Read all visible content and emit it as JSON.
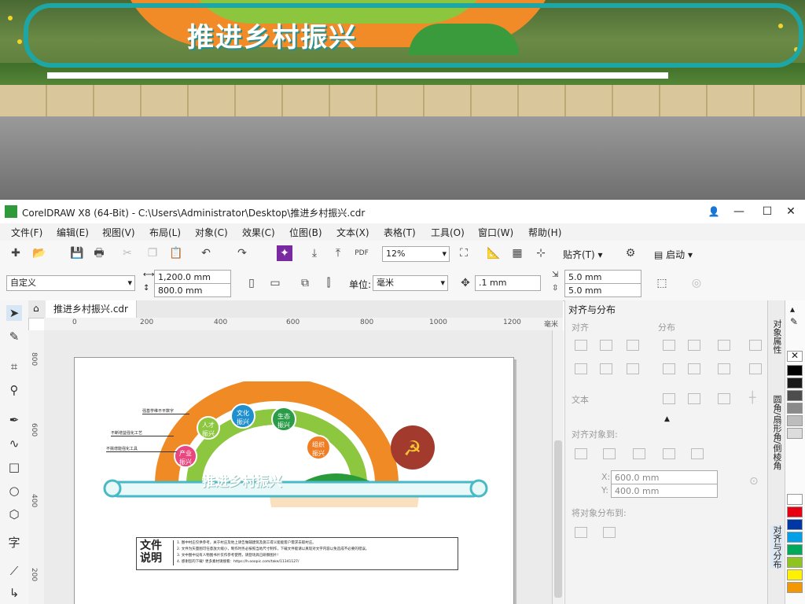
{
  "photo": {
    "banner_text": "推进乡村振兴"
  },
  "window": {
    "title": "CorelDRAW X8 (64-Bit) - C:\\Users\\Administrator\\Desktop\\推进乡村振兴.cdr",
    "controls": {
      "minimize": "—",
      "maximize": "☐",
      "close": "✕"
    }
  },
  "menu": [
    "文件(F)",
    "编辑(E)",
    "视图(V)",
    "布局(L)",
    "对象(C)",
    "效果(C)",
    "位图(B)",
    "文本(X)",
    "表格(T)",
    "工具(O)",
    "窗口(W)",
    "帮助(H)"
  ],
  "toolbar1": {
    "zoom": "12%",
    "snap_label": "贴齐(T)",
    "launch_label": "启动"
  },
  "toolbar2": {
    "page_preset": "自定义",
    "width": "1,200.0 mm",
    "height": "800.0 mm",
    "units_label": "单位:",
    "units_value": "毫米",
    "nudge": ".1 mm",
    "dup_x": "5.0 mm",
    "dup_y": "5.0 mm"
  },
  "document": {
    "tab": "推进乡村振兴.cdr"
  },
  "ruler_h": [
    "0",
    "200",
    "400",
    "600",
    "800",
    "1000",
    "1200"
  ],
  "ruler_h_unit": "毫米",
  "ruler_v": [
    "800",
    "600",
    "400",
    "200"
  ],
  "artwork": {
    "banner": "推进乡村振兴",
    "circles": [
      {
        "line1": "产业",
        "line2": "振兴",
        "color": "#e9457e"
      },
      {
        "line1": "人才",
        "line2": "振兴",
        "color": "#8dc63f"
      },
      {
        "line1": "文化",
        "line2": "振兴",
        "color": "#1f8fce"
      },
      {
        "line1": "生态",
        "line2": "振兴",
        "color": "#2a9b47"
      },
      {
        "line1": "组织",
        "line2": "振兴",
        "color": "#f07e25"
      }
    ],
    "callouts": [
      "强基学维不平数字",
      "不断增益强化工艺",
      "不挑增能强化工具"
    ],
    "notes_title_1": "文件",
    "notes_title_2": "说明",
    "notes": [
      "1. 图中村庄仅供参考，关于村庄及地上请告做辅建筑及施工得义能能客户需求去取村庄。",
      "2. 文件为矢量图可任意放大缩小，制作时务必按照当地尺寸制作，下载文件能请以真现对文字内容以免造成不必要的错误。",
      "3. 文中图中设有人物图书片仅作参考使用，请登场具已研察图片!",
      "4. 感谢您的下载! 更多素材请搜看：https://h.ooopic.com/take/11341127/"
    ]
  },
  "panel": {
    "title": "对齐与分布",
    "align_label": "对齐",
    "distribute_label": "分布",
    "text_label": "文本",
    "align_to_label": "对齐对象到:",
    "x_label": "X:",
    "x_value": "600.0 mm",
    "y_label": "Y:",
    "y_value": "400.0 mm",
    "distribute_to_label": "将对象分布到:"
  },
  "side_tabs": [
    "对象属性",
    "圆角/扇形角/倒棱角",
    "对齐与分布"
  ],
  "palette": [
    "#ffffff",
    "#000000",
    "#1a1a1a",
    "#4d4d4d",
    "#8a8a8a",
    "#bdbdbd",
    "#dcdcdc",
    "#ffffff",
    "#e60012",
    "#0037a6",
    "#00a0e9",
    "#00a85a",
    "#8fc31f",
    "#fff100",
    "#f39800",
    "#e4007f"
  ]
}
